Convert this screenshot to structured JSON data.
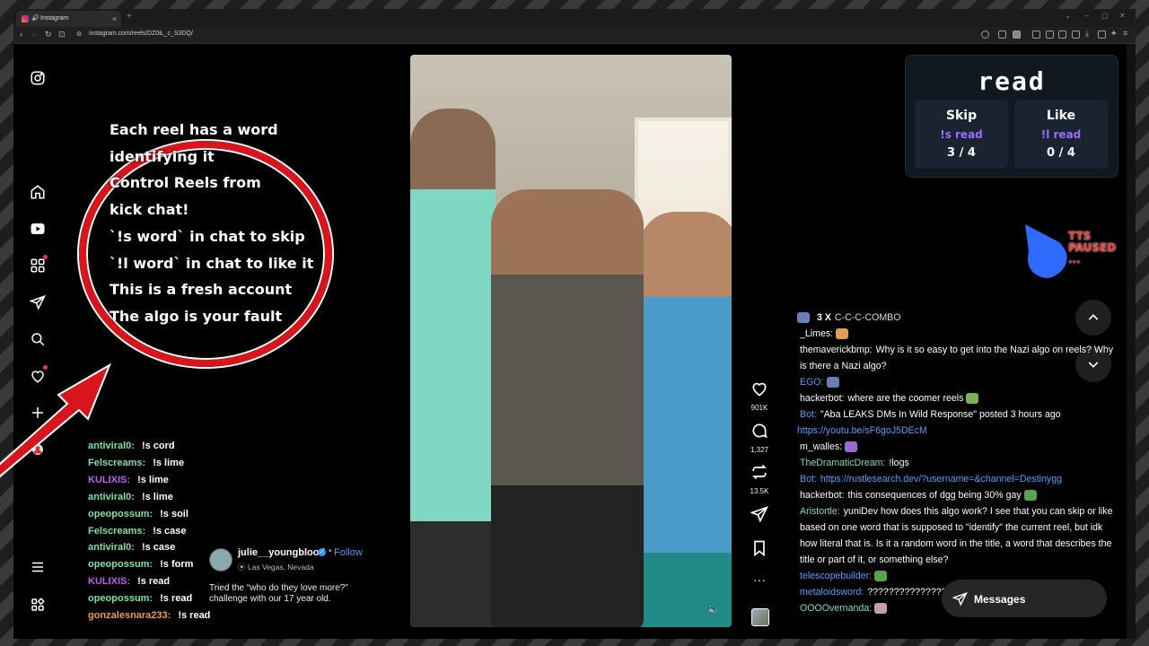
{
  "browser": {
    "tab_title": "Instagram",
    "url": "instagram.com/reels/DZ0iL_c_S3DQ/"
  },
  "overlay": {
    "instructions": [
      "Each reel has a word",
      "identifying it",
      "Control Reels from",
      "kick chat!",
      "`!s word` in chat to skip",
      "`!l word` in chat to like it",
      "This is a fresh account",
      "The algo is your fault"
    ]
  },
  "vote": {
    "word": "read",
    "skip": {
      "label": "Skip",
      "command": "!s read",
      "count": "3 / 4"
    },
    "like": {
      "label": "Like",
      "command": "!l read",
      "count": "0 / 4"
    }
  },
  "tts": {
    "line1": "TTS",
    "line2": "PAUSED",
    "line3": "..."
  },
  "left_chat": [
    {
      "user": "antiviral0:",
      "text": "!s cord",
      "color": "#7ee2a8"
    },
    {
      "user": "Felscreams:",
      "text": "!s lime",
      "color": "#7ee2a8"
    },
    {
      "user": "KULIXIS:",
      "text": "!s lime",
      "color": "#c35cf5"
    },
    {
      "user": "antiviral0:",
      "text": "!s lime",
      "color": "#7ee2a8"
    },
    {
      "user": "opeopossum:",
      "text": "!s soil",
      "color": "#7ee2a8"
    },
    {
      "user": "Felscreams:",
      "text": "!s case",
      "color": "#7ee2a8"
    },
    {
      "user": "antiviral0:",
      "text": "!s case",
      "color": "#7ee2a8"
    },
    {
      "user": "opeopossum:",
      "text": "!s form",
      "color": "#7ee2a8"
    },
    {
      "user": "KULIXIS:",
      "text": "!s read",
      "color": "#c35cf5"
    },
    {
      "user": "opeopossum:",
      "text": "!s read",
      "color": "#7ee2a8"
    },
    {
      "user": "gonzalesnara233:",
      "text": "!s read",
      "color": "#f0a030"
    }
  ],
  "reel": {
    "username": "julie__youngblood",
    "follow": "Follow",
    "location": "Las Vegas, Nevada",
    "caption": "Tried the “who do they love more?” challenge with our 17 year old.",
    "likes": "901K",
    "comments": "1,327",
    "reposts": "13.5K"
  },
  "right_chat": [
    {
      "user": "3 X",
      "text": "C-C-C-COMBO",
      "user_color": "#ffffff",
      "text_color": "#dddddd"
    },
    {
      "user": "_Limes:",
      "text": "",
      "user_color": "#ffffff",
      "text_color": "#ffffff"
    },
    {
      "user": "themaverickbmp:",
      "text": "Why is it so easy to get into the Nazi algo on reels? Why is there a Nazi algo?",
      "user_color": "#ffffff",
      "text_color": "#ffffff"
    },
    {
      "user": "EGO:",
      "text": "",
      "user_color": "#4ea0ff",
      "text_color": "#ffffff"
    },
    {
      "user": "hackerbot:",
      "text": "where are the coomer reels",
      "user_color": "#ffffff",
      "text_color": "#ffffff"
    },
    {
      "user": "Bot:",
      "text": "\"Aba LEAKS DMs In Wild Response\" posted 3 hours ago",
      "user_color": "#4ea0ff",
      "text_color": "#ffffff"
    },
    {
      "user": "",
      "text": "https://youtu.be/sF6goJ5DEcM",
      "user_color": "#4ea0ff",
      "text_color": "#4ea0ff"
    },
    {
      "user": "m_walles:",
      "text": "",
      "user_color": "#ffffff",
      "text_color": "#ffffff"
    },
    {
      "user": "TheDramaticDream:",
      "text": "!logs",
      "user_color": "#7ee2a8",
      "text_color": "#ffffff"
    },
    {
      "user": "Bot:",
      "text": "https://rustlesearch.dev/?username=&channel=Destinygg",
      "user_color": "#4ea0ff",
      "text_color": "#4ea0ff"
    },
    {
      "user": "hackerbot:",
      "text": "this consequences of dgg being 30% gay",
      "user_color": "#ffffff",
      "text_color": "#ffffff"
    },
    {
      "user": "Aristortle:",
      "text": "yuniDev how does this algo work? I see that you can skip or like based on one word that is supposed to \"identify\" the current reel, but idk how literal that is. Is it a random word in the title, a word that describes the title or part of it, or something else?",
      "user_color": "#7ee2a8",
      "text_color": "#ffffff"
    },
    {
      "user": "telescopebuilder:",
      "text": "",
      "user_color": "#4ea0ff",
      "text_color": "#ffffff"
    },
    {
      "user": "metaloidsword:",
      "text": "?????????????????",
      "user_color": "#4ea0ff",
      "text_color": "#ffffff"
    },
    {
      "user": "OOOOvernanda:",
      "text": "",
      "user_color": "#7ee2a8",
      "text_color": "#ffffff"
    }
  ],
  "messages_button": "Messages"
}
